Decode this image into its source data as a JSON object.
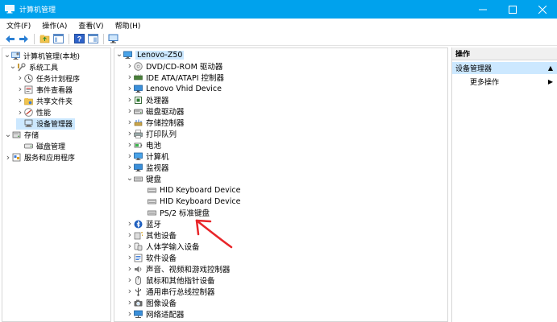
{
  "window": {
    "title": "计算机管理"
  },
  "menu": [
    "文件(F)",
    "操作(A)",
    "查看(V)",
    "帮助(H)"
  ],
  "left_tree": [
    {
      "label": "计算机管理(本地)",
      "icon": "computer-management-icon",
      "arrow": "down"
    },
    {
      "label": "系统工具",
      "icon": "system-tools-icon",
      "arrow": "down"
    },
    {
      "label": "任务计划程序",
      "icon": "task-scheduler-icon",
      "arrow": "right"
    },
    {
      "label": "事件查看器",
      "icon": "event-viewer-icon",
      "arrow": "right"
    },
    {
      "label": "共享文件夹",
      "icon": "shared-folders-icon",
      "arrow": "right"
    },
    {
      "label": "性能",
      "icon": "performance-icon",
      "arrow": "right"
    },
    {
      "label": "设备管理器",
      "icon": "device-manager-icon",
      "arrow": "",
      "selected": true
    },
    {
      "label": "存储",
      "icon": "storage-icon",
      "arrow": "down"
    },
    {
      "label": "磁盘管理",
      "icon": "disk-management-icon",
      "arrow": ""
    },
    {
      "label": "服务和应用程序",
      "icon": "services-apps-icon",
      "arrow": "right"
    }
  ],
  "device_tree": [
    {
      "label": "Lenovo-Z50",
      "icon": "computer-icon",
      "arrow": "down",
      "root": true
    },
    {
      "label": "DVD/CD-ROM 驱动器",
      "icon": "dvd-drive-icon",
      "arrow": "right"
    },
    {
      "label": "IDE ATA/ATAPI 控制器",
      "icon": "ide-controller-icon",
      "arrow": "right"
    },
    {
      "label": "Lenovo Vhid Device",
      "icon": "monitor-icon",
      "arrow": "right"
    },
    {
      "label": "处理器",
      "icon": "processor-icon",
      "arrow": "right"
    },
    {
      "label": "磁盘驱动器",
      "icon": "disk-drive-icon",
      "arrow": "right"
    },
    {
      "label": "存储控制器",
      "icon": "storage-controller-icon",
      "arrow": "right"
    },
    {
      "label": "打印队列",
      "icon": "print-queue-icon",
      "arrow": "right"
    },
    {
      "label": "电池",
      "icon": "battery-icon",
      "arrow": "right"
    },
    {
      "label": "计算机",
      "icon": "computer-icon",
      "arrow": "right"
    },
    {
      "label": "监视器",
      "icon": "monitor-icon",
      "arrow": "right"
    },
    {
      "label": "键盘",
      "icon": "keyboard-icon",
      "arrow": "down"
    },
    {
      "label": "HID Keyboard Device",
      "icon": "keyboard-icon",
      "arrow": "",
      "child": true
    },
    {
      "label": "HID Keyboard Device",
      "icon": "keyboard-icon",
      "arrow": "",
      "child": true
    },
    {
      "label": "PS/2 标准键盘",
      "icon": "keyboard-icon",
      "arrow": "",
      "child": true
    },
    {
      "label": "蓝牙",
      "icon": "bluetooth-icon",
      "arrow": "right"
    },
    {
      "label": "其他设备",
      "icon": "other-devices-icon",
      "arrow": "right"
    },
    {
      "label": "人体学输入设备",
      "icon": "hid-icon",
      "arrow": "right"
    },
    {
      "label": "软件设备",
      "icon": "software-device-icon",
      "arrow": "right"
    },
    {
      "label": "声音、视频和游戏控制器",
      "icon": "sound-icon",
      "arrow": "right"
    },
    {
      "label": "鼠标和其他指针设备",
      "icon": "mouse-icon",
      "arrow": "right"
    },
    {
      "label": "通用串行总线控制器",
      "icon": "usb-icon",
      "arrow": "right"
    },
    {
      "label": "图像设备",
      "icon": "imaging-device-icon",
      "arrow": "right"
    },
    {
      "label": "网络适配器",
      "icon": "network-adapter-icon",
      "arrow": "right"
    }
  ],
  "actions": {
    "header": "操作",
    "section": "设备管理器",
    "more": "更多操作"
  },
  "colors": {
    "titlebar": "#00a2ed",
    "selection": "#cce8ff",
    "annotation": "#e8262a"
  }
}
